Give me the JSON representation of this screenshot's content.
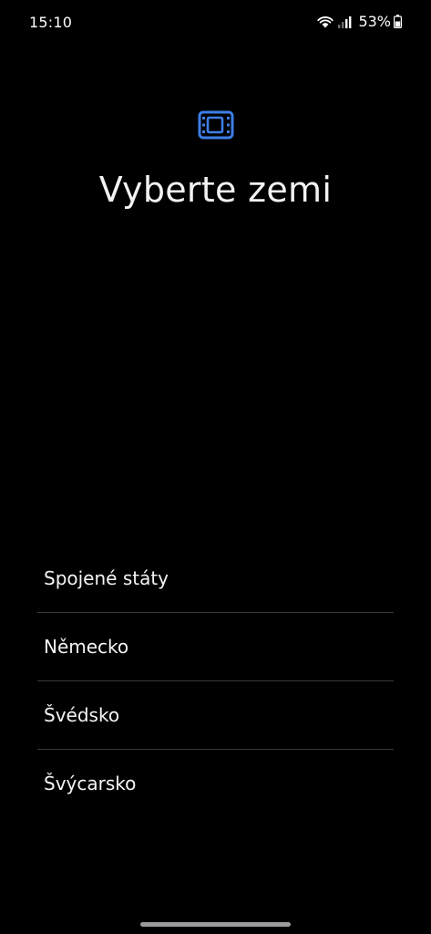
{
  "status_bar": {
    "time": "15:10",
    "battery": "53%",
    "icons": [
      "wifi-icon",
      "signal-icon",
      "battery-icon"
    ]
  },
  "app_icon": {
    "name": "film-icon",
    "color": "#3d7ee6"
  },
  "title": "Vyberte zemi",
  "countries": [
    {
      "label": "Spojené státy"
    },
    {
      "label": "Německo"
    },
    {
      "label": "Švédsko"
    },
    {
      "label": "Švýcarsko"
    }
  ]
}
